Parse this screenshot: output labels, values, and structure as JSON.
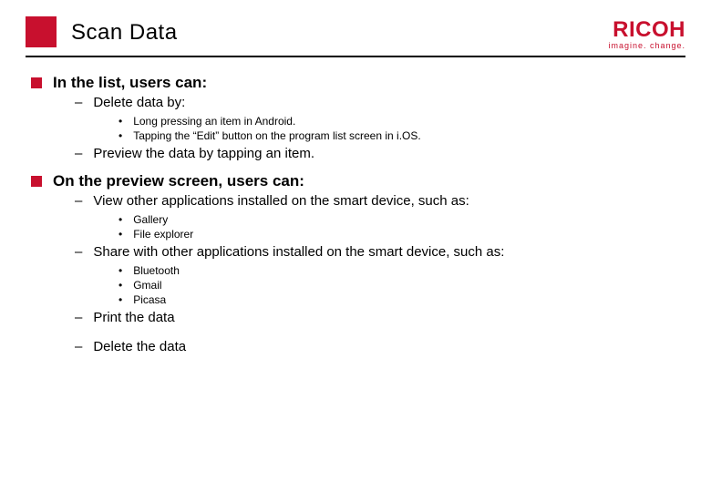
{
  "title": "Scan Data",
  "logo": {
    "name": "RICOH",
    "tagline": "imagine. change."
  },
  "sections": [
    {
      "heading": "In the list, users can:",
      "items": [
        {
          "text": "Delete data by:",
          "subitems": [
            "Long pressing an item in Android.",
            "Tapping the “Edit” button on the program list screen in i.OS."
          ]
        },
        {
          "text": "Preview the data by tapping an item."
        }
      ]
    },
    {
      "heading": "On the preview screen, users can:",
      "items": [
        {
          "text": "View other applications installed on the smart device, such as:",
          "subitems": [
            "Gallery",
            "File explorer"
          ]
        },
        {
          "text": "Share with other applications installed on the smart device, such as:",
          "subitems": [
            "Bluetooth",
            "Gmail",
            "Picasa"
          ]
        },
        {
          "text": "Print the data"
        },
        {
          "text": "Delete the data"
        }
      ]
    }
  ]
}
